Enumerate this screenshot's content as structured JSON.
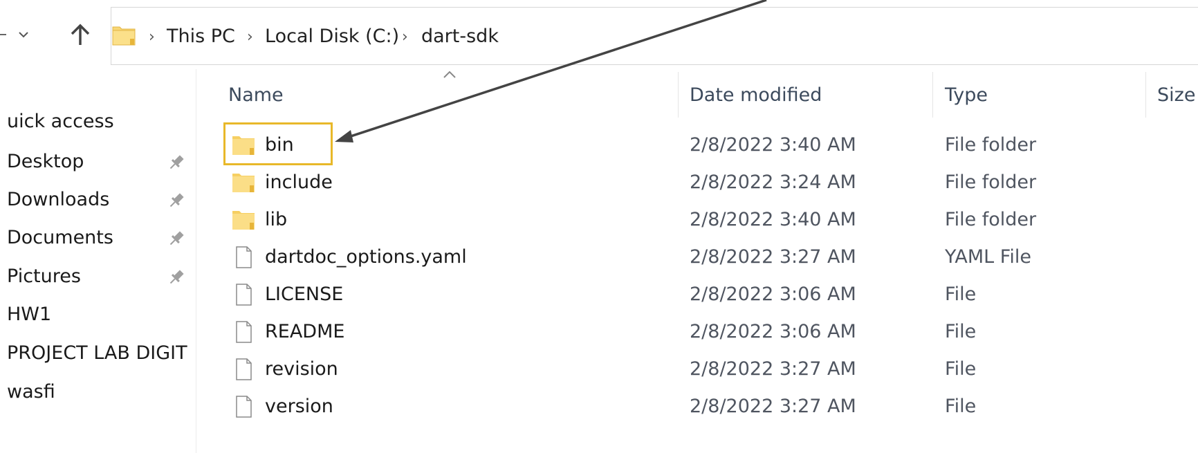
{
  "address_bar": {
    "crumbs": [
      "This PC",
      "Local Disk (C:)",
      "dart-sdk"
    ],
    "separator": "›"
  },
  "sidebar": {
    "items": [
      {
        "label": "uick access",
        "pinned": false
      },
      {
        "label": "Desktop",
        "pinned": true
      },
      {
        "label": "Downloads",
        "pinned": true
      },
      {
        "label": "Documents",
        "pinned": true
      },
      {
        "label": "Pictures",
        "pinned": true
      },
      {
        "label": "HW1",
        "pinned": false
      },
      {
        "label": "PROJECT LAB DIGIT",
        "pinned": false
      },
      {
        "label": "wasfi",
        "pinned": false
      }
    ]
  },
  "columns": {
    "name": "Name",
    "date_modified": "Date modified",
    "type": "Type",
    "size": "Size"
  },
  "files": [
    {
      "name": "bin",
      "date": "2/8/2022 3:40 AM",
      "type": "File folder",
      "icon": "folder-icon"
    },
    {
      "name": "include",
      "date": "2/8/2022 3:24 AM",
      "type": "File folder",
      "icon": "folder-icon"
    },
    {
      "name": "lib",
      "date": "2/8/2022 3:40 AM",
      "type": "File folder",
      "icon": "folder-icon"
    },
    {
      "name": "dartdoc_options.yaml",
      "date": "2/8/2022 3:27 AM",
      "type": "YAML File",
      "icon": "file-icon"
    },
    {
      "name": "LICENSE",
      "date": "2/8/2022 3:06 AM",
      "type": "File",
      "icon": "file-icon"
    },
    {
      "name": "README",
      "date": "2/8/2022 3:06 AM",
      "type": "File",
      "icon": "file-icon"
    },
    {
      "name": "revision",
      "date": "2/8/2022 3:27 AM",
      "type": "File",
      "icon": "file-icon"
    },
    {
      "name": "version",
      "date": "2/8/2022 3:27 AM",
      "type": "File",
      "icon": "file-icon"
    }
  ],
  "colors": {
    "highlight": "#e8b829",
    "folder": "#f8d775",
    "arrow": "#444444"
  }
}
